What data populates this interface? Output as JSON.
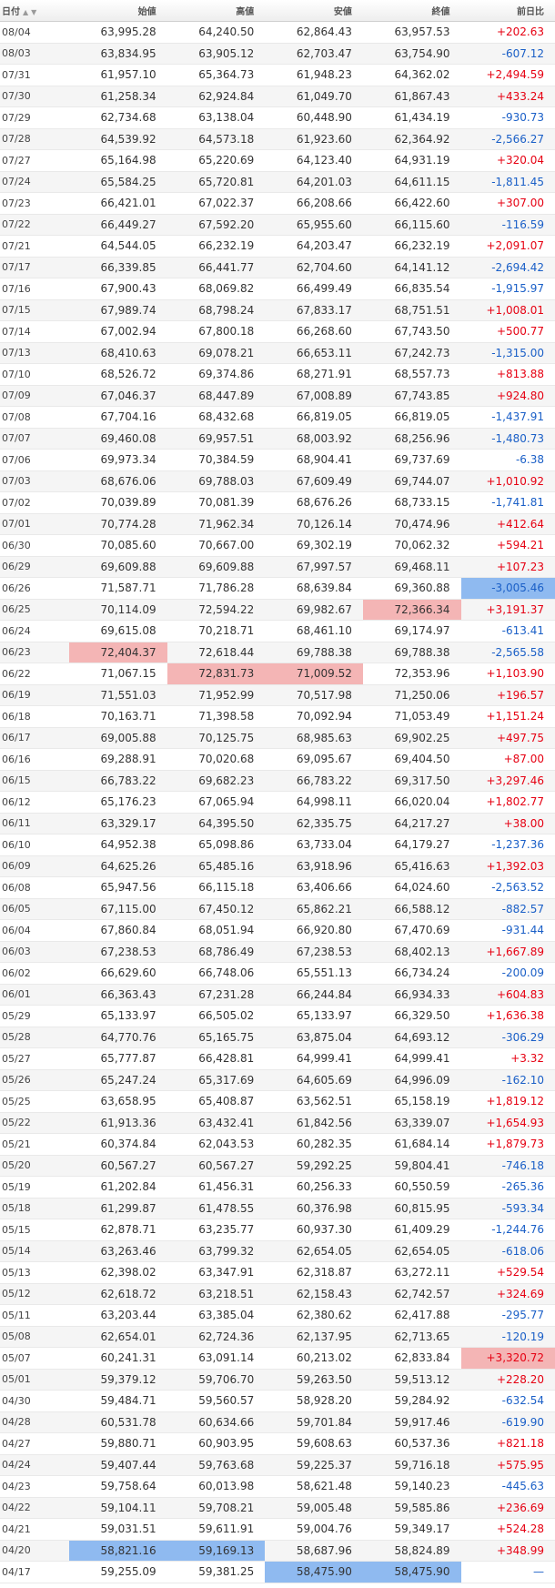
{
  "header": {
    "date": "日付",
    "open": "始値",
    "high": "高値",
    "low": "安値",
    "close": "終値",
    "change": "前日比"
  },
  "colors": {
    "positive": "#e60012",
    "negative": "#1a5fc7",
    "max_highlight": "#f4b5b5",
    "min_highlight": "#8fbaf0"
  },
  "rows": [
    {
      "date": "08/04",
      "open": "63,995.28",
      "high": "64,240.50",
      "low": "62,864.43",
      "close": "63,957.53",
      "change": "+202.63"
    },
    {
      "date": "08/03",
      "open": "63,834.95",
      "high": "63,905.12",
      "low": "62,703.47",
      "close": "63,754.90",
      "change": "-607.12"
    },
    {
      "date": "07/31",
      "open": "61,957.10",
      "high": "65,364.73",
      "low": "61,948.23",
      "close": "64,362.02",
      "change": "+2,494.59"
    },
    {
      "date": "07/30",
      "open": "61,258.34",
      "high": "62,924.84",
      "low": "61,049.70",
      "close": "61,867.43",
      "change": "+433.24"
    },
    {
      "date": "07/29",
      "open": "62,734.68",
      "high": "63,138.04",
      "low": "60,448.90",
      "close": "61,434.19",
      "change": "-930.73"
    },
    {
      "date": "07/28",
      "open": "64,539.92",
      "high": "64,573.18",
      "low": "61,923.60",
      "close": "62,364.92",
      "change": "-2,566.27"
    },
    {
      "date": "07/27",
      "open": "65,164.98",
      "high": "65,220.69",
      "low": "64,123.40",
      "close": "64,931.19",
      "change": "+320.04"
    },
    {
      "date": "07/24",
      "open": "65,584.25",
      "high": "65,720.81",
      "low": "64,201.03",
      "close": "64,611.15",
      "change": "-1,811.45"
    },
    {
      "date": "07/23",
      "open": "66,421.01",
      "high": "67,022.37",
      "low": "66,208.66",
      "close": "66,422.60",
      "change": "+307.00"
    },
    {
      "date": "07/22",
      "open": "66,449.27",
      "high": "67,592.20",
      "low": "65,955.60",
      "close": "66,115.60",
      "change": "-116.59"
    },
    {
      "date": "07/21",
      "open": "64,544.05",
      "high": "66,232.19",
      "low": "64,203.47",
      "close": "66,232.19",
      "change": "+2,091.07"
    },
    {
      "date": "07/17",
      "open": "66,339.85",
      "high": "66,441.77",
      "low": "62,704.60",
      "close": "64,141.12",
      "change": "-2,694.42"
    },
    {
      "date": "07/16",
      "open": "67,900.43",
      "high": "68,069.82",
      "low": "66,499.49",
      "close": "66,835.54",
      "change": "-1,915.97"
    },
    {
      "date": "07/15",
      "open": "67,989.74",
      "high": "68,798.24",
      "low": "67,833.17",
      "close": "68,751.51",
      "change": "+1,008.01"
    },
    {
      "date": "07/14",
      "open": "67,002.94",
      "high": "67,800.18",
      "low": "66,268.60",
      "close": "67,743.50",
      "change": "+500.77"
    },
    {
      "date": "07/13",
      "open": "68,410.63",
      "high": "69,078.21",
      "low": "66,653.11",
      "close": "67,242.73",
      "change": "-1,315.00"
    },
    {
      "date": "07/10",
      "open": "68,526.72",
      "high": "69,374.86",
      "low": "68,271.91",
      "close": "68,557.73",
      "change": "+813.88"
    },
    {
      "date": "07/09",
      "open": "67,046.37",
      "high": "68,447.89",
      "low": "67,008.89",
      "close": "67,743.85",
      "change": "+924.80"
    },
    {
      "date": "07/08",
      "open": "67,704.16",
      "high": "68,432.68",
      "low": "66,819.05",
      "close": "66,819.05",
      "change": "-1,437.91"
    },
    {
      "date": "07/07",
      "open": "69,460.08",
      "high": "69,957.51",
      "low": "68,003.92",
      "close": "68,256.96",
      "change": "-1,480.73"
    },
    {
      "date": "07/06",
      "open": "69,973.34",
      "high": "70,384.59",
      "low": "68,904.41",
      "close": "69,737.69",
      "change": "-6.38"
    },
    {
      "date": "07/03",
      "open": "68,676.06",
      "high": "69,788.03",
      "low": "67,609.49",
      "close": "69,744.07",
      "change": "+1,010.92"
    },
    {
      "date": "07/02",
      "open": "70,039.89",
      "high": "70,081.39",
      "low": "68,676.26",
      "close": "68,733.15",
      "change": "-1,741.81"
    },
    {
      "date": "07/01",
      "open": "70,774.28",
      "high": "71,962.34",
      "low": "70,126.14",
      "close": "70,474.96",
      "change": "+412.64"
    },
    {
      "date": "06/30",
      "open": "70,085.60",
      "high": "70,667.00",
      "low": "69,302.19",
      "close": "70,062.32",
      "change": "+594.21"
    },
    {
      "date": "06/29",
      "open": "69,609.88",
      "high": "69,609.88",
      "low": "67,997.57",
      "close": "69,468.11",
      "change": "+107.23"
    },
    {
      "date": "06/26",
      "open": "71,587.71",
      "high": "71,786.28",
      "low": "68,639.84",
      "close": "69,360.88",
      "change": "-3,005.46"
    },
    {
      "date": "06/25",
      "open": "70,114.09",
      "high": "72,594.22",
      "low": "69,982.67",
      "close": "72,366.34",
      "change": "+3,191.37"
    },
    {
      "date": "06/24",
      "open": "69,615.08",
      "high": "70,218.71",
      "low": "68,461.10",
      "close": "69,174.97",
      "change": "-613.41"
    },
    {
      "date": "06/23",
      "open": "72,404.37",
      "high": "72,618.44",
      "low": "69,788.38",
      "close": "69,788.38",
      "change": "-2,565.58"
    },
    {
      "date": "06/22",
      "open": "71,067.15",
      "high": "72,831.73",
      "low": "71,009.52",
      "close": "72,353.96",
      "change": "+1,103.90"
    },
    {
      "date": "06/19",
      "open": "71,551.03",
      "high": "71,952.99",
      "low": "70,517.98",
      "close": "71,250.06",
      "change": "+196.57"
    },
    {
      "date": "06/18",
      "open": "70,163.71",
      "high": "71,398.58",
      "low": "70,092.94",
      "close": "71,053.49",
      "change": "+1,151.24"
    },
    {
      "date": "06/17",
      "open": "69,005.88",
      "high": "70,125.75",
      "low": "68,985.63",
      "close": "69,902.25",
      "change": "+497.75"
    },
    {
      "date": "06/16",
      "open": "69,288.91",
      "high": "70,020.68",
      "low": "69,095.67",
      "close": "69,404.50",
      "change": "+87.00"
    },
    {
      "date": "06/15",
      "open": "66,783.22",
      "high": "69,682.23",
      "low": "66,783.22",
      "close": "69,317.50",
      "change": "+3,297.46"
    },
    {
      "date": "06/12",
      "open": "65,176.23",
      "high": "67,065.94",
      "low": "64,998.11",
      "close": "66,020.04",
      "change": "+1,802.77"
    },
    {
      "date": "06/11",
      "open": "63,329.17",
      "high": "64,395.50",
      "low": "62,335.75",
      "close": "64,217.27",
      "change": "+38.00"
    },
    {
      "date": "06/10",
      "open": "64,952.38",
      "high": "65,098.86",
      "low": "63,733.04",
      "close": "64,179.27",
      "change": "-1,237.36"
    },
    {
      "date": "06/09",
      "open": "64,625.26",
      "high": "65,485.16",
      "low": "63,918.96",
      "close": "65,416.63",
      "change": "+1,392.03"
    },
    {
      "date": "06/08",
      "open": "65,947.56",
      "high": "66,115.18",
      "low": "63,406.66",
      "close": "64,024.60",
      "change": "-2,563.52"
    },
    {
      "date": "06/05",
      "open": "67,115.00",
      "high": "67,450.12",
      "low": "65,862.21",
      "close": "66,588.12",
      "change": "-882.57"
    },
    {
      "date": "06/04",
      "open": "67,860.84",
      "high": "68,051.94",
      "low": "66,920.80",
      "close": "67,470.69",
      "change": "-931.44"
    },
    {
      "date": "06/03",
      "open": "67,238.53",
      "high": "68,786.49",
      "low": "67,238.53",
      "close": "68,402.13",
      "change": "+1,667.89"
    },
    {
      "date": "06/02",
      "open": "66,629.60",
      "high": "66,748.06",
      "low": "65,551.13",
      "close": "66,734.24",
      "change": "-200.09"
    },
    {
      "date": "06/01",
      "open": "66,363.43",
      "high": "67,231.28",
      "low": "66,244.84",
      "close": "66,934.33",
      "change": "+604.83"
    },
    {
      "date": "05/29",
      "open": "65,133.97",
      "high": "66,505.02",
      "low": "65,133.97",
      "close": "66,329.50",
      "change": "+1,636.38"
    },
    {
      "date": "05/28",
      "open": "64,770.76",
      "high": "65,165.75",
      "low": "63,875.04",
      "close": "64,693.12",
      "change": "-306.29"
    },
    {
      "date": "05/27",
      "open": "65,777.87",
      "high": "66,428.81",
      "low": "64,999.41",
      "close": "64,999.41",
      "change": "+3.32"
    },
    {
      "date": "05/26",
      "open": "65,247.24",
      "high": "65,317.69",
      "low": "64,605.69",
      "close": "64,996.09",
      "change": "-162.10"
    },
    {
      "date": "05/25",
      "open": "63,658.95",
      "high": "65,408.87",
      "low": "63,562.51",
      "close": "65,158.19",
      "change": "+1,819.12"
    },
    {
      "date": "05/22",
      "open": "61,913.36",
      "high": "63,432.41",
      "low": "61,842.56",
      "close": "63,339.07",
      "change": "+1,654.93"
    },
    {
      "date": "05/21",
      "open": "60,374.84",
      "high": "62,043.53",
      "low": "60,282.35",
      "close": "61,684.14",
      "change": "+1,879.73"
    },
    {
      "date": "05/20",
      "open": "60,567.27",
      "high": "60,567.27",
      "low": "59,292.25",
      "close": "59,804.41",
      "change": "-746.18"
    },
    {
      "date": "05/19",
      "open": "61,202.84",
      "high": "61,456.31",
      "low": "60,256.33",
      "close": "60,550.59",
      "change": "-265.36"
    },
    {
      "date": "05/18",
      "open": "61,299.87",
      "high": "61,478.55",
      "low": "60,376.98",
      "close": "60,815.95",
      "change": "-593.34"
    },
    {
      "date": "05/15",
      "open": "62,878.71",
      "high": "63,235.77",
      "low": "60,937.30",
      "close": "61,409.29",
      "change": "-1,244.76"
    },
    {
      "date": "05/14",
      "open": "63,263.46",
      "high": "63,799.32",
      "low": "62,654.05",
      "close": "62,654.05",
      "change": "-618.06"
    },
    {
      "date": "05/13",
      "open": "62,398.02",
      "high": "63,347.91",
      "low": "62,318.87",
      "close": "63,272.11",
      "change": "+529.54"
    },
    {
      "date": "05/12",
      "open": "62,618.72",
      "high": "63,218.51",
      "low": "62,158.43",
      "close": "62,742.57",
      "change": "+324.69"
    },
    {
      "date": "05/11",
      "open": "63,203.44",
      "high": "63,385.04",
      "low": "62,380.62",
      "close": "62,417.88",
      "change": "-295.77"
    },
    {
      "date": "05/08",
      "open": "62,654.01",
      "high": "62,724.36",
      "low": "62,137.95",
      "close": "62,713.65",
      "change": "-120.19"
    },
    {
      "date": "05/07",
      "open": "60,241.31",
      "high": "63,091.14",
      "low": "60,213.02",
      "close": "62,833.84",
      "change": "+3,320.72"
    },
    {
      "date": "05/01",
      "open": "59,379.12",
      "high": "59,706.70",
      "low": "59,263.50",
      "close": "59,513.12",
      "change": "+228.20"
    },
    {
      "date": "04/30",
      "open": "59,484.71",
      "high": "59,560.57",
      "low": "58,928.20",
      "close": "59,284.92",
      "change": "-632.54"
    },
    {
      "date": "04/28",
      "open": "60,531.78",
      "high": "60,634.66",
      "low": "59,701.84",
      "close": "59,917.46",
      "change": "-619.90"
    },
    {
      "date": "04/27",
      "open": "59,880.71",
      "high": "60,903.95",
      "low": "59,608.63",
      "close": "60,537.36",
      "change": "+821.18"
    },
    {
      "date": "04/24",
      "open": "59,407.44",
      "high": "59,763.68",
      "low": "59,225.37",
      "close": "59,716.18",
      "change": "+575.95"
    },
    {
      "date": "04/23",
      "open": "59,758.64",
      "high": "60,013.98",
      "low": "58,621.48",
      "close": "59,140.23",
      "change": "-445.63"
    },
    {
      "date": "04/22",
      "open": "59,104.11",
      "high": "59,708.21",
      "low": "59,005.48",
      "close": "59,585.86",
      "change": "+236.69"
    },
    {
      "date": "04/21",
      "open": "59,031.51",
      "high": "59,611.91",
      "low": "59,004.76",
      "close": "59,349.17",
      "change": "+524.28"
    },
    {
      "date": "04/20",
      "open": "58,821.16",
      "high": "59,169.13",
      "low": "58,687.96",
      "close": "58,824.89",
      "change": "+348.99"
    },
    {
      "date": "04/17",
      "open": "59,255.09",
      "high": "59,381.25",
      "low": "58,475.90",
      "close": "58,475.90",
      "change": "—"
    }
  ]
}
